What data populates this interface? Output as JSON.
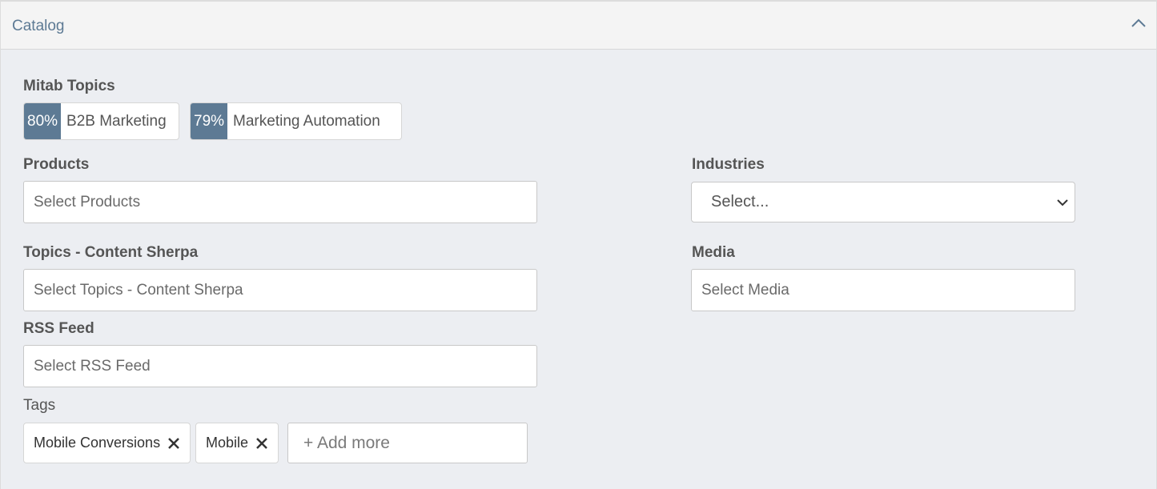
{
  "header": {
    "title": "Catalog",
    "collapse_icon": "chevron-up-icon"
  },
  "mitab_topics": {
    "label": "Mitab Topics",
    "chips": [
      {
        "percent": "80%",
        "name": "B2B Marketing"
      },
      {
        "percent": "79%",
        "name": "Marketing Automation"
      }
    ]
  },
  "products": {
    "label": "Products",
    "placeholder": "Select Products"
  },
  "industries": {
    "label": "Industries",
    "selected": "Select..."
  },
  "topics_content_sherpa": {
    "label": "Topics - Content Sherpa",
    "placeholder": "Select Topics - Content Sherpa"
  },
  "media": {
    "label": "Media",
    "placeholder": "Select Media"
  },
  "rss_feed": {
    "label": "RSS Feed",
    "placeholder": "Select RSS Feed"
  },
  "tags": {
    "label": "Tags",
    "items": [
      {
        "name": "Mobile Conversions",
        "remove_icon": "close-icon"
      },
      {
        "name": "Mobile",
        "remove_icon": "close-icon"
      }
    ],
    "add_more": "+ Add more"
  },
  "colors": {
    "accent": "#5d7a94",
    "background": "#eceef2",
    "header_bg": "#f4f4f4"
  }
}
